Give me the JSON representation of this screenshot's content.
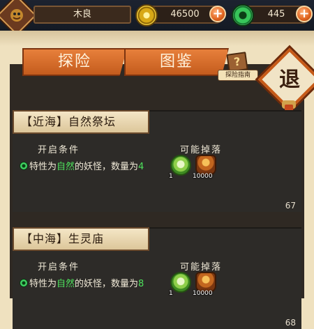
{
  "player": {
    "name": "木良"
  },
  "resources": {
    "coins": {
      "value": "46500",
      "icon": "gold-coin-icon",
      "add_label": "+"
    },
    "jade": {
      "value": "445",
      "icon": "jade-coin-icon",
      "add_label": "+"
    }
  },
  "tabs": [
    {
      "label": "探险",
      "active": true
    },
    {
      "label": "图鉴",
      "active": false
    }
  ],
  "guide": {
    "icon_text": "?",
    "label": "探险指南"
  },
  "exit": {
    "label": "退"
  },
  "stages": [
    {
      "title": "【近海】自然祭坛",
      "condition_label": "开启条件",
      "drop_label": "可能掉落",
      "condition_prefix": "特性为",
      "condition_trait": "自然",
      "condition_mid": "的妖怪，数量为",
      "condition_count": "4",
      "drops": [
        {
          "icon": "jade-gem-icon",
          "count": "1"
        },
        {
          "icon": "money-bag-icon",
          "count": "10000"
        }
      ],
      "number": "67"
    },
    {
      "title": "【中海】生灵庙",
      "condition_label": "开启条件",
      "drop_label": "可能掉落",
      "condition_prefix": "特性为",
      "condition_trait": "自然",
      "condition_mid": "的妖怪，数量为",
      "condition_count": "8",
      "drops": [
        {
          "icon": "jade-gem-icon",
          "count": "1"
        },
        {
          "icon": "money-bag-icon",
          "count": "10000"
        }
      ],
      "number": "68"
    }
  ],
  "colors": {
    "accent": "#d9692a",
    "highlight": "#4de05c",
    "panel": "#2d2b28",
    "frame": "#efe1bf"
  }
}
